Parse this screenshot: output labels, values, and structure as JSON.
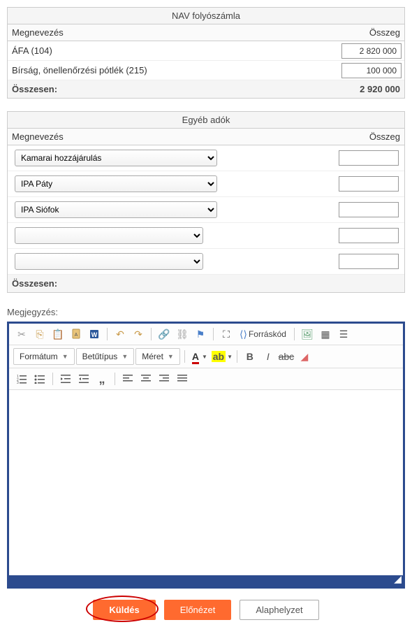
{
  "nav_table": {
    "title": "NAV folyószámla",
    "col_name": "Megnevezés",
    "col_amount": "Összeg",
    "rows": [
      {
        "label": "ÁFA (104)",
        "value": "2 820 000"
      },
      {
        "label": "Bírság, önellenőrzési pótlék (215)",
        "value": "100 000"
      }
    ],
    "total_label": "Összesen:",
    "total_value": "2 920 000"
  },
  "other_table": {
    "title": "Egyéb adók",
    "col_name": "Megnevezés",
    "col_amount": "Összeg",
    "selects": [
      {
        "value": "Kamarai hozzájárulás",
        "amount": ""
      },
      {
        "value": "IPA Páty",
        "amount": ""
      },
      {
        "value": "IPA Siófok",
        "amount": ""
      },
      {
        "value": "",
        "amount": ""
      },
      {
        "value": "",
        "amount": ""
      }
    ],
    "total_label": "Összesen:",
    "total_value": ""
  },
  "notes": {
    "label": "Megjegyzés:",
    "format_dropdown": "Formátum",
    "font_dropdown": "Betűtípus",
    "size_dropdown": "Méret",
    "source_label": "Forráskód"
  },
  "buttons": {
    "submit": "Küldés",
    "preview": "Előnézet",
    "reset": "Alaphelyzet"
  },
  "colors": {
    "primary": "#ff6a2f",
    "editorFrame": "#2c4b8e",
    "highlight": "#c00"
  }
}
